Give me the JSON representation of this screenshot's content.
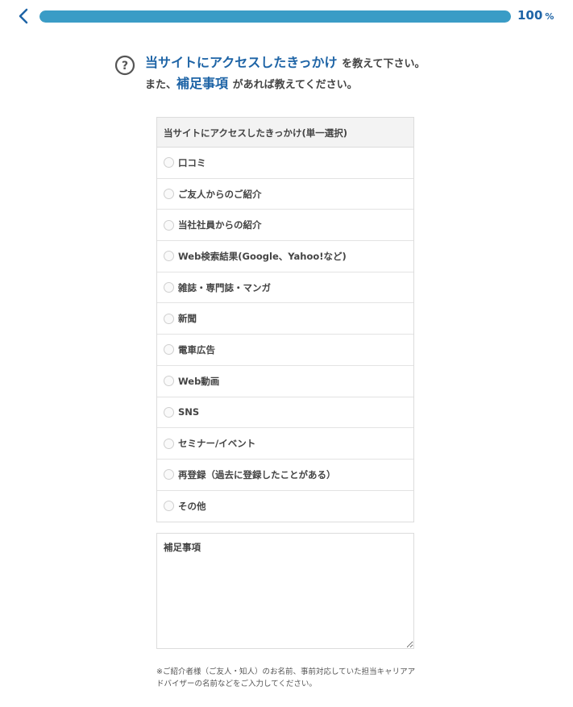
{
  "progress": {
    "value": 100,
    "label": "100",
    "unit": "%",
    "fill_color": "#3a9cc6",
    "text_color": "#1e64a6"
  },
  "nav": {
    "back_icon": "chevron-left-icon"
  },
  "question": {
    "icon": "question-circle-icon",
    "line1_highlight": "当サイトにアクセスしたきっかけ",
    "line1_rest": "を教えて下さい。",
    "line2_prefix": "また、",
    "line2_highlight": "補足事項",
    "line2_rest": "があれば教えてください。"
  },
  "choices": {
    "header": "当サイトにアクセスしたきっかけ(単一選択)",
    "options": [
      "口コミ",
      "ご友人からのご紹介",
      "当社社員からの紹介",
      "Web検索結果(Google、Yahoo!など)",
      "雑誌・専門誌・マンガ",
      "新聞",
      "電車広告",
      "Web動画",
      "SNS",
      "セミナー/イベント",
      "再登録（過去に登録したことがある）",
      "その他"
    ]
  },
  "notes": {
    "placeholder": "補足事項",
    "value": ""
  },
  "footnote": "※ご紹介者様（ご友人・知人）のお名前、事前対応していた担当キャリアアドバイザーの名前などをご入力してください。"
}
